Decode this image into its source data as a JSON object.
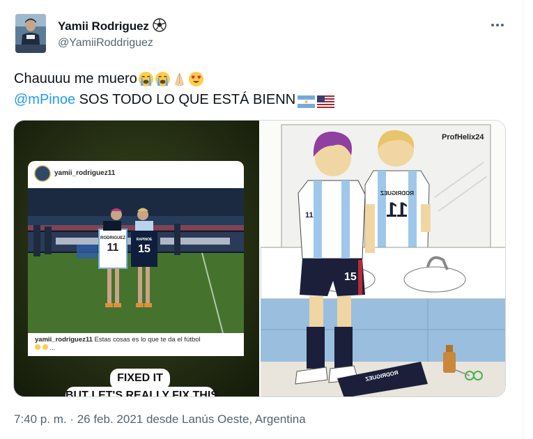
{
  "author": {
    "name": "Yamii Rodriguez",
    "name_emoji": "soccer-ball-icon",
    "handle": "@YamiiRoddriguez"
  },
  "tweet": {
    "line1": "Chauuuu me muero",
    "line1_emojis": [
      "loudly-crying-face-icon",
      "loudly-crying-face-icon",
      "folded-hands-icon",
      "heart-eyes-face-icon"
    ],
    "mention": "@mPinoe",
    "line2_rest": " SOS TODO LO QUE ESTÁ BIENN",
    "line2_flags": [
      "argentina-flag-icon",
      "usa-flag-icon"
    ]
  },
  "media": {
    "left": {
      "post_user": "yamii_rodriguez11",
      "caption_user": "yamii_rodriguez11",
      "caption_text": "Estas cosas es lo que te da el fútbol",
      "caption_more": "...",
      "jersey_left": "RODRIGUEZ",
      "jersey_left_number": "11",
      "jersey_right": "RAPINOE",
      "jersey_right_number": "15",
      "sticker_line1": "FIXED IT",
      "sticker_line2": "BUT LET'S REALLY FIX THIS"
    },
    "right": {
      "artist_tag": "ProfHelix24",
      "mirror_jersey": "RODRIGUEZ",
      "mirror_number": "11",
      "shirt_number": "11",
      "shorts_number": "15",
      "floor_jersey": "RODRIGUEZ"
    }
  },
  "timestamp": "7:40 p. m. · 26 feb. 2021 desde Lanús Oeste, Argentina",
  "colors": {
    "link": "#1d9bf0",
    "muted": "#536471",
    "text": "#0f1419"
  }
}
